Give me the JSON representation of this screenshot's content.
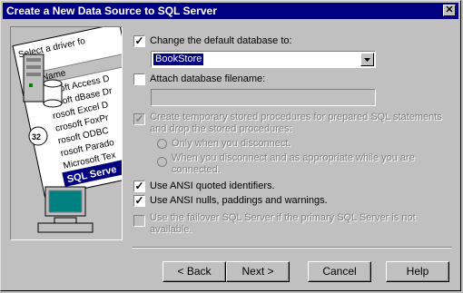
{
  "window": {
    "title": "Create a New Data Source to SQL Server"
  },
  "options": {
    "change_default_db": {
      "label": "Change the default database to:",
      "checked": true
    },
    "database_value": "BookStore",
    "attach_db": {
      "label": "Attach database filename:",
      "checked": false
    },
    "temp_procs": {
      "label_line1": "Create temporary stored procedures for prepared SQL statements",
      "label_line2": "and drop the stored procedures:"
    },
    "radio_disconnect": "Only when you disconnect.",
    "radio_appropriate_line1": "When you disconnect and as appropriate while you are",
    "radio_appropriate_line2": "connected.",
    "ansi_quoted": {
      "label": "Use ANSI quoted identifiers.",
      "checked": true
    },
    "ansi_nulls": {
      "label": "Use ANSI nulls, paddings and warnings.",
      "checked": true
    },
    "failover_line1": "Use the failover SQL Server if the primary SQL Server is not",
    "failover_line2": "available."
  },
  "art": {
    "header": "Select a driver fo",
    "column": "Name",
    "items": [
      "rosoft Access D",
      "rosoft dBase Dr",
      "rosoft Excel D",
      "crosoft FoxPr",
      "rosoft ODBC",
      "rosoft Parado",
      "Microsoft Tex",
      "SQL Serve"
    ]
  },
  "buttons": {
    "back": "< Back",
    "next": "Next >",
    "cancel": "Cancel",
    "help": "Help"
  }
}
